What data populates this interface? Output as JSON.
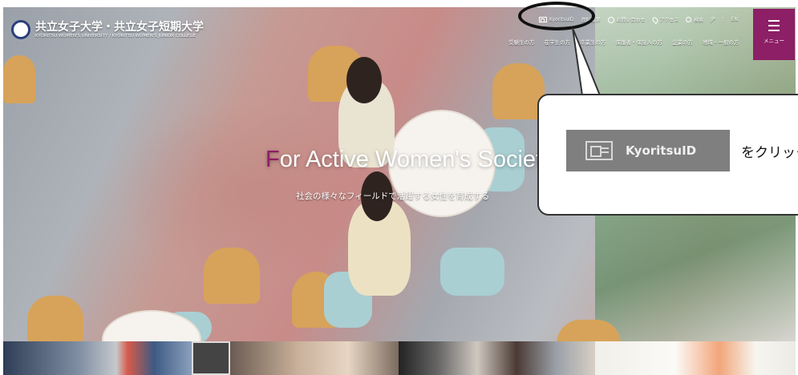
{
  "header": {
    "logo_title": "共立女子大学・共立女子短期大学",
    "logo_subtitle": "KYORITSU WOMEN'S UNIVERSITY / KYORITSU WOMEN'S JUNIOR COLLEGE",
    "top_links": {
      "kyoritsu_id": "KyoritsuID",
      "materials": "資料請求",
      "contact": "お問い合わせ",
      "access": "アクセス",
      "search": "検索",
      "ja": "JP",
      "en": "EN"
    },
    "sub_nav": [
      "受験生の方",
      "在学生の方",
      "卒業生の方",
      "保護者・保証人の方",
      "企業の方",
      "地域・一般の方"
    ],
    "menu_label": "メニュー"
  },
  "hero": {
    "tagline_first": "F",
    "tagline_rest": "or Active Women's Society",
    "subtagline": "社会の様々なフィールドで活躍する女性を育成する"
  },
  "callout": {
    "button_label": "KyoritsuID",
    "instruction": "をクリック"
  },
  "colors": {
    "brand": "#8c1f66",
    "navy": "#2a3f7a"
  }
}
